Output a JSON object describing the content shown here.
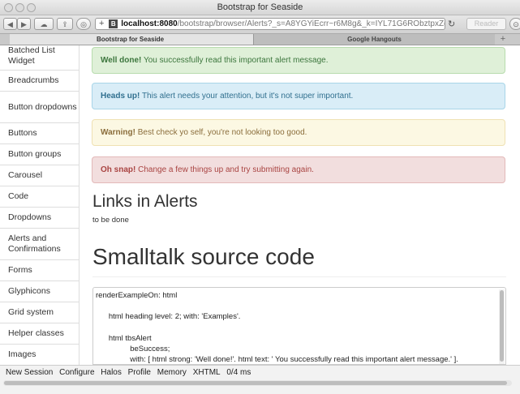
{
  "window": {
    "title": "Bootstrap for Seaside"
  },
  "toolbar": {
    "url_favicon": "B",
    "url_host": "localhost:8080",
    "url_path": "/bootstrap/browser/Alerts?_s=A8YGYiEcrr~r6M8g&_k=IYL71G6RObztpxZq",
    "reader_label": "Reader"
  },
  "tabs": [
    {
      "label": "Bootstrap for Seaside"
    },
    {
      "label": "Google Hangouts"
    }
  ],
  "sidebar": {
    "items": [
      {
        "label": "Batched List Widget"
      },
      {
        "label": "Breadcrumbs"
      },
      {
        "label": "Button dropdowns"
      },
      {
        "label": "Buttons"
      },
      {
        "label": "Button groups"
      },
      {
        "label": "Carousel"
      },
      {
        "label": "Code"
      },
      {
        "label": "Dropdowns"
      },
      {
        "label": "Alerts and Confirmations"
      },
      {
        "label": "Forms"
      },
      {
        "label": "Glyphicons"
      },
      {
        "label": "Grid system"
      },
      {
        "label": "Helper classes"
      },
      {
        "label": "Images"
      }
    ]
  },
  "alerts": {
    "success": {
      "strong": "Well done!",
      "text": " You successfully read this important alert message."
    },
    "info": {
      "strong": "Heads up!",
      "text": " This alert needs your attention, but it's not super important."
    },
    "warning": {
      "strong": "Warning!",
      "text": " Best check yo self, you're not looking too good."
    },
    "danger": {
      "strong": "Oh snap!",
      "text": " Change a few things up and try submitting again."
    }
  },
  "links_section": {
    "heading": "Links in Alerts",
    "body": "to be done"
  },
  "source_section": {
    "heading": "Smalltalk source code",
    "code": "renderExampleOn: html\n\n      html heading level: 2; with: 'Examples'.\n\n      html tbsAlert\n                beSuccess;\n                with: [ html strong: 'Well done!'. html text: ' You successfully read this important alert message.' ]."
  },
  "statusbar": {
    "links": [
      "New Session",
      "Configure",
      "Halos",
      "Profile",
      "Memory",
      "XHTML"
    ],
    "timing": "0/4 ms"
  },
  "colors": {
    "success_bg": "#dff0d8",
    "info_bg": "#d9edf7",
    "warning_bg": "#fcf8e3",
    "danger_bg": "#f2dede"
  }
}
